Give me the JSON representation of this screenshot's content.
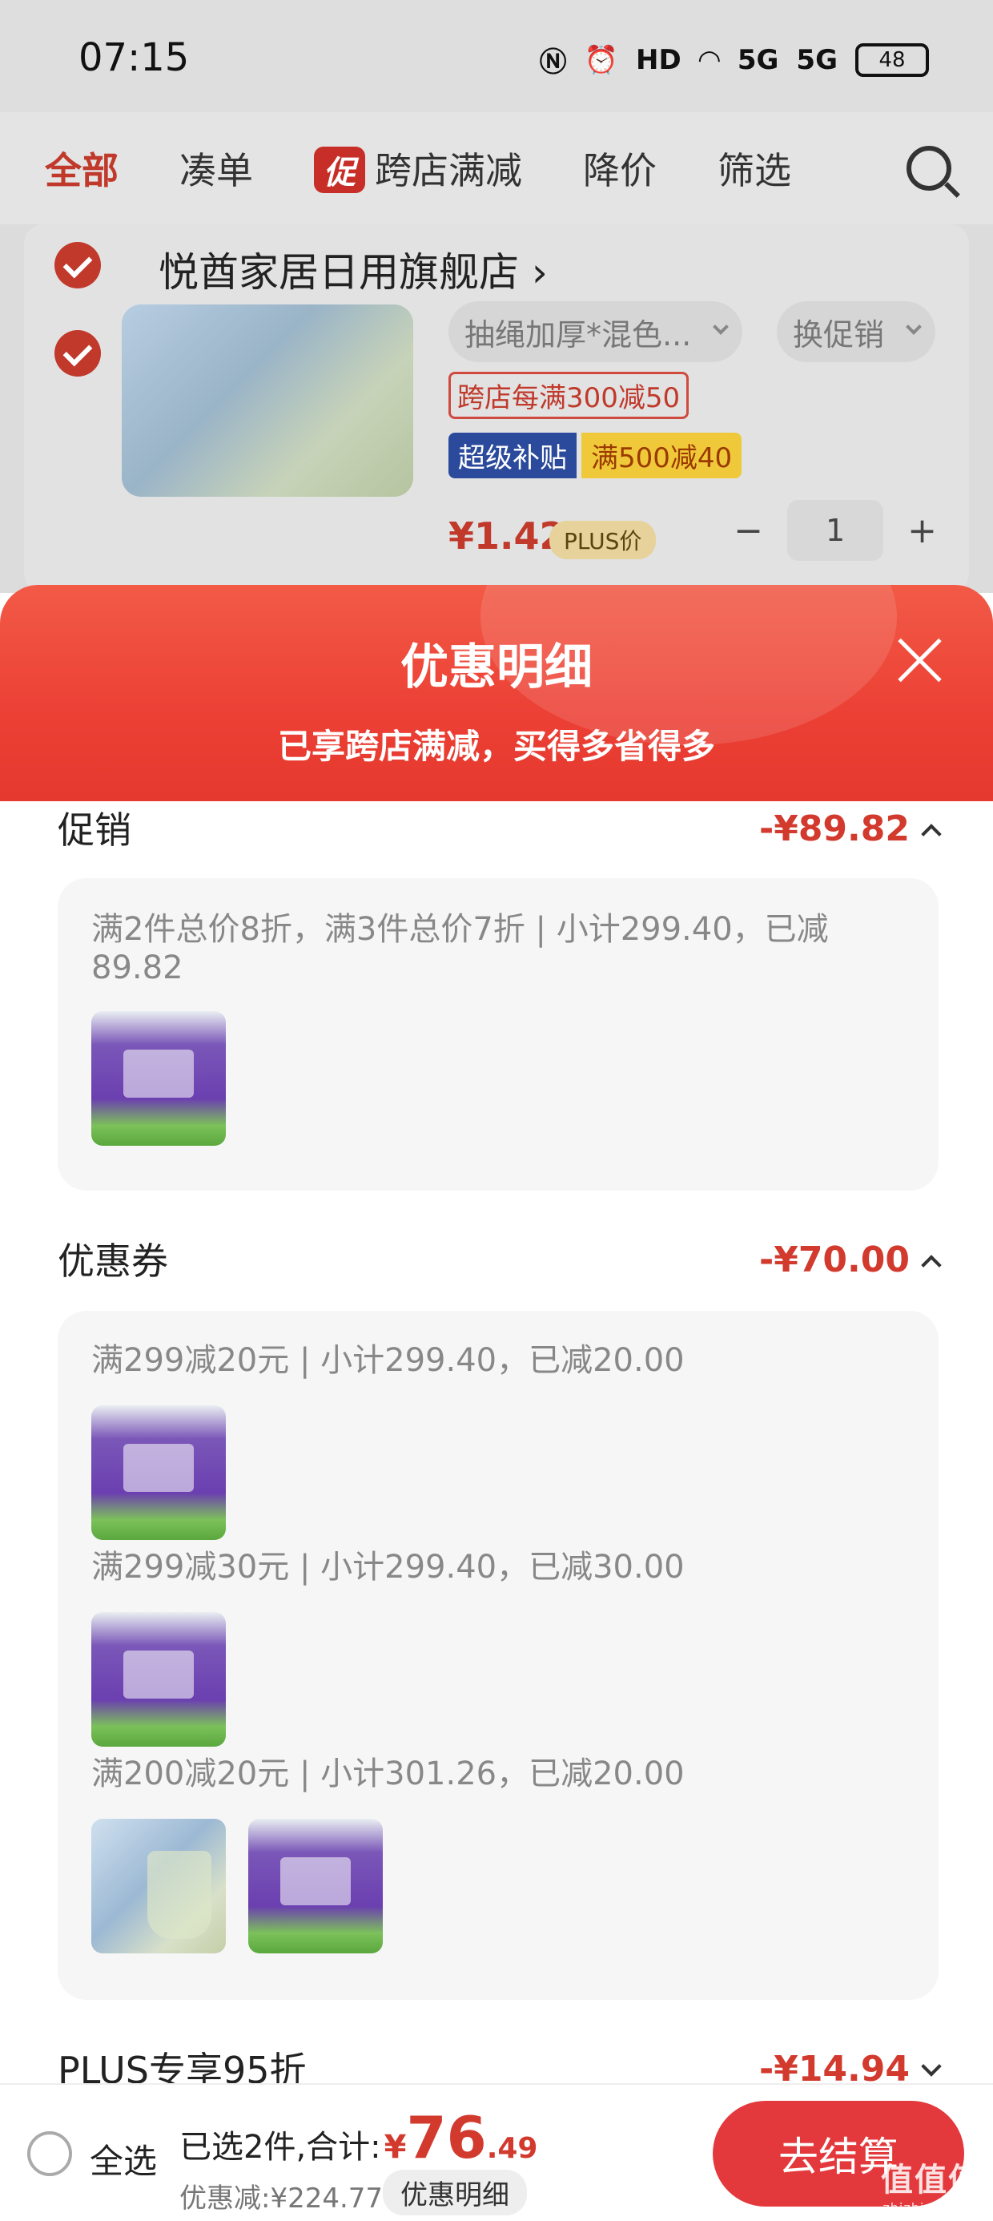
{
  "status_bar": {
    "time": "07:15",
    "network_1": "5G",
    "network_2": "5G",
    "battery": "48",
    "hd_label": "HD"
  },
  "tabs": {
    "all": "全部",
    "combine": "凑单",
    "promo_badge": "促",
    "cross_store": "跨店满减",
    "price_drop": "降价",
    "filter": "筛选"
  },
  "store": {
    "name": "悦酋家居日用旗舰店",
    "chevron": "›"
  },
  "product": {
    "sku": "抽绳加厚*混色...",
    "promo_switch": "换促销",
    "cross_store_tag": "跨店每满300减50",
    "subsidy_tag": "超级补贴",
    "subsidy_value": "满500减40",
    "price": "¥1.42",
    "plus_tag": "PLUS价",
    "minus": "−",
    "quantity": "1",
    "plus": "+"
  },
  "modal": {
    "title": "优惠明细",
    "subtitle": "已享跨店满减，买得多省得多",
    "sections": [
      {
        "title": "促销",
        "amount": "-¥89.82",
        "desc": "满2件总价8折，满3件总价7折 | 小计299.40，已减89.82"
      },
      {
        "title": "优惠券",
        "amount": "-¥70.00",
        "items": [
          "满299减20元 | 小计299.40，已减20.00",
          "满299减30元 | 小计299.40，已减30.00",
          "满200减20元 | 小计301.26，已减20.00"
        ]
      },
      {
        "title": "PLUS专享95折",
        "amount": "-¥14.94"
      }
    ]
  },
  "bottom": {
    "select_all": "全选",
    "selected_label": "已选2件,合计:",
    "currency": "¥",
    "total_int": "76",
    "total_dec": ".49",
    "discount_label": "优惠减:¥224.77",
    "detail_button": "优惠明细",
    "checkout": "去结算"
  },
  "watermark": {
    "text": "值值值",
    "url": "zhizhizhi.com"
  },
  "colors": {
    "accent": "#e4393c",
    "price_red": "#d23a2e"
  }
}
